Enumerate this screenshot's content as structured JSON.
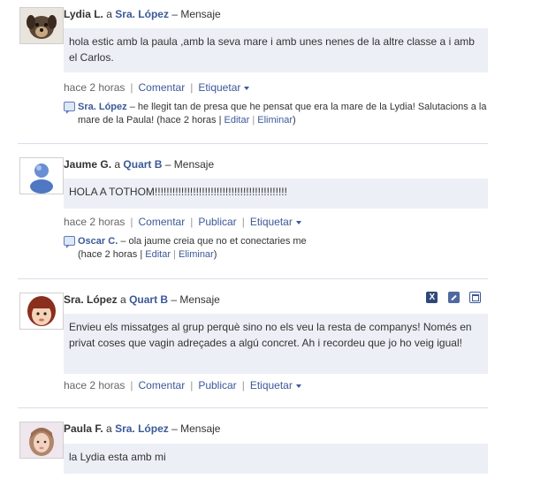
{
  "posts": [
    {
      "author": "Lydia L.",
      "to_word": "a",
      "group": "Sra. López",
      "type": "– Mensaje",
      "message": "hola estic amb la paula ,amb la seva mare i amb unes nenes de la altre classe a i amb el Carlos.",
      "time": "hace 2 horas",
      "actions": [
        "Comentar",
        "Etiquetar"
      ],
      "comment": {
        "author": "Sra. López",
        "text": "– he llegit tan de presa que he pensat que era la mare de la Lydia! Salutacions a la mare de la Paula! (hace 2 horas |",
        "edit": "Editar",
        "sep": "|",
        "delete": "Eliminar",
        "close": ")"
      }
    },
    {
      "author": "Jaume G.",
      "to_word": "a",
      "group": "Quart B",
      "type": "– Mensaje",
      "message": "HOLA A TOTHOM!!!!!!!!!!!!!!!!!!!!!!!!!!!!!!!!!!!!!!!!!!!!!",
      "time": "hace 2 horas",
      "actions": [
        "Comentar",
        "Publicar",
        "Etiquetar"
      ],
      "comment": {
        "author": "Oscar C.",
        "text": "– ola jaume creia que no et conectaries me",
        "text2": "(hace 2 horas |",
        "edit": "Editar",
        "sep": "|",
        "delete": "Eliminar",
        "close": ")"
      }
    },
    {
      "author": "Sra. López",
      "to_word": "a",
      "group": "Quart B",
      "type": "– Mensaje",
      "message": "Envieu els missatges al grup perquè sino no els veu la resta de companys! Només en privat coses que vagin adreçades a algú concret. Ah i recordeu que jo ho veig igual!",
      "time": "hace 2 horas",
      "actions": [
        "Comentar",
        "Publicar",
        "Etiquetar"
      ],
      "icons": [
        "x-icon",
        "edit-icon",
        "window-icon"
      ],
      "icon_x_label": "X"
    },
    {
      "author": "Paula F.",
      "to_word": "a",
      "group": "Sra. López",
      "type": "– Mensaje",
      "message": "la Lydia esta amb mi"
    }
  ],
  "colors": {
    "link": "#3b5998",
    "bubble": "#eceff5",
    "divider": "#d8dfea"
  }
}
